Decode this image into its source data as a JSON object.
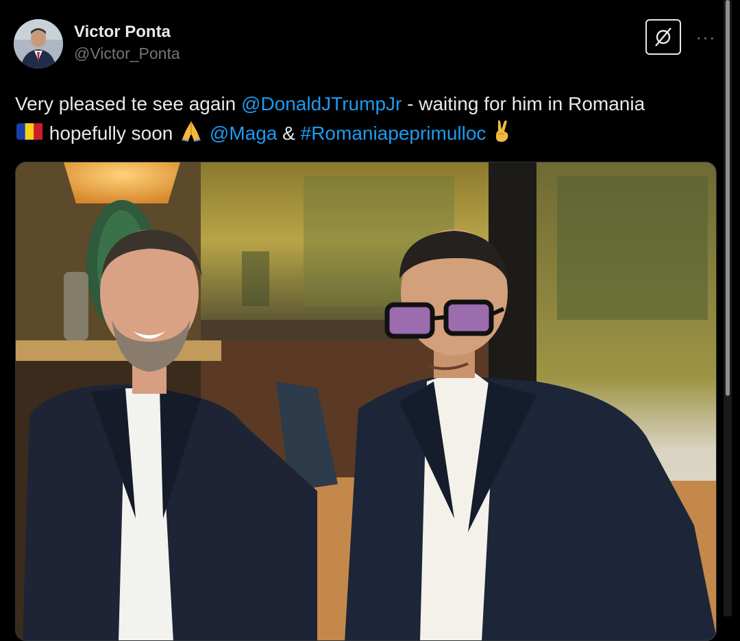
{
  "author": {
    "display_name": "Victor Ponta",
    "handle": "@Victor_Ponta"
  },
  "actions": {
    "grok_icon": "grok-icon",
    "more_label": "···"
  },
  "tweet": {
    "line1_prefix": "Very pleased te see again ",
    "mention_trump": "@DonaldJTrumpJr",
    "line1_suffix": " - waiting for him in Romania",
    "line2_part1": " hopefully soon ",
    "mention_maga": "@Maga",
    "amp": " & ",
    "hashtag": "#Romaniapeprimulloc",
    "emojis": [
      "romania-flag-emoji",
      "folded-hands-emoji",
      "victory-hand-emoji"
    ]
  },
  "media": {
    "description_icon": "photo-two-men-restaurant"
  },
  "colors": {
    "background": "#000000",
    "text": "#e7e9ea",
    "secondary": "#71767b",
    "link": "#1d9bf0"
  }
}
